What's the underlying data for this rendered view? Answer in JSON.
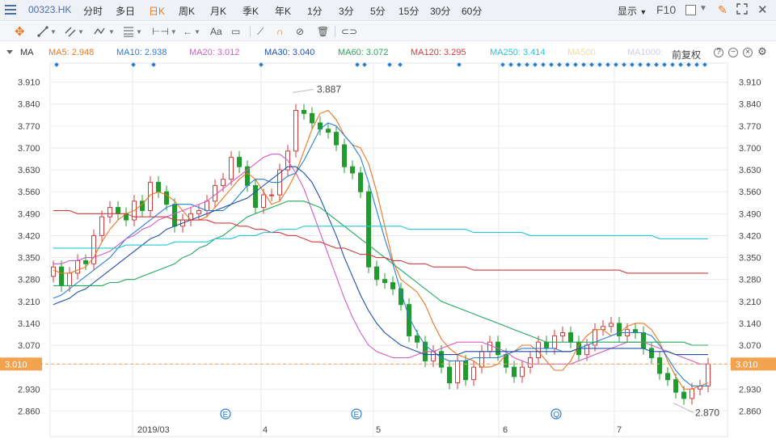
{
  "toolbar": {
    "stock_code": "00323.HK",
    "periods": [
      "分时",
      "多日",
      "日K",
      "周K",
      "月K",
      "季K",
      "年K",
      "1分",
      "3分",
      "5分",
      "15分",
      "30分",
      "60分"
    ],
    "active_period": "日K",
    "display_label": "显示",
    "f10_label": "F10"
  },
  "drawing_tools": {
    "text_tool_label": "Aa"
  },
  "ma": {
    "title": "MA",
    "items": [
      {
        "label": "MA5: 2.948",
        "color": "#e8771f"
      },
      {
        "label": "MA10: 2.938",
        "color": "#2a7fd4"
      },
      {
        "label": "MA20: 3.012",
        "color": "#d65ac5"
      },
      {
        "label": "MA30: 3.040",
        "color": "#1f4fa8"
      },
      {
        "label": "MA60: 3.072",
        "color": "#22a85a"
      },
      {
        "label": "MA120: 3.295",
        "color": "#d63a3a"
      },
      {
        "label": "MA250: 3.414",
        "color": "#24c6d8"
      },
      {
        "label": "MA500",
        "color": "#f0dc9a"
      },
      {
        "label": "MA1000:",
        "color": "#d7c9e8"
      }
    ],
    "adjust_label": "前复权"
  },
  "chart": {
    "y_ticks": [
      "3.910",
      "3.840",
      "3.770",
      "3.700",
      "3.630",
      "3.560",
      "3.490",
      "3.420",
      "3.350",
      "3.280",
      "3.210",
      "3.140",
      "3.070",
      "3.010",
      "2.930",
      "2.860"
    ],
    "current_price": "3.010",
    "high_label": "3.887",
    "low_label": "2.870",
    "x_labels": [
      "2019/03",
      "4",
      "5",
      "6",
      "7"
    ],
    "events": [
      "E",
      "E",
      "Q"
    ],
    "colors": {
      "up": "#d63a3a",
      "down": "#1f9c2c",
      "grid": "#e6ebf2",
      "current": "#f3a24d",
      "marker": "#2a7fd4"
    }
  },
  "chart_data": {
    "type": "candlestick",
    "ylim": [
      2.83,
      3.94
    ],
    "series": [
      {
        "name": "MA5",
        "values": [
          3.31,
          3.3,
          3.3,
          3.31,
          3.32,
          3.35,
          3.4,
          3.44,
          3.47,
          3.49,
          3.5,
          3.52,
          3.55,
          3.56,
          3.55,
          3.53,
          3.5,
          3.47,
          3.47,
          3.48,
          3.51,
          3.54,
          3.57,
          3.6,
          3.62,
          3.6,
          3.56,
          3.52,
          3.53,
          3.57,
          3.62,
          3.69,
          3.76,
          3.81,
          3.82,
          3.79,
          3.74,
          3.71,
          3.7,
          3.65,
          3.56,
          3.45,
          3.34,
          3.28,
          3.26,
          3.24,
          3.2,
          3.14,
          3.09,
          3.06,
          3.04,
          3.03,
          3.02,
          3.0,
          3.0,
          3.01,
          3.04,
          3.05,
          3.07,
          3.07,
          3.05,
          3.02,
          2.99,
          2.99,
          3.02,
          3.07,
          3.1,
          3.12,
          3.12,
          3.1,
          3.11,
          3.13,
          3.14,
          3.14,
          3.12,
          3.08,
          3.02,
          2.97,
          2.93,
          2.93,
          2.94,
          2.95
        ]
      },
      {
        "name": "MA10",
        "values": [
          3.22,
          3.23,
          3.25,
          3.27,
          3.29,
          3.31,
          3.33,
          3.35,
          3.38,
          3.41,
          3.43,
          3.45,
          3.47,
          3.49,
          3.51,
          3.52,
          3.52,
          3.52,
          3.51,
          3.5,
          3.5,
          3.5,
          3.52,
          3.55,
          3.58,
          3.6,
          3.6,
          3.59,
          3.59,
          3.61,
          3.62,
          3.66,
          3.71,
          3.76,
          3.78,
          3.77,
          3.74,
          3.71,
          3.67,
          3.59,
          3.5,
          3.41,
          3.33,
          3.24,
          3.16,
          3.11,
          3.07,
          3.05,
          3.03,
          3.02,
          3.02,
          3.02,
          3.03,
          3.03,
          3.03,
          3.03,
          3.04,
          3.05,
          3.06,
          3.06,
          3.06,
          3.06,
          3.06,
          3.05,
          3.05,
          3.06,
          3.07,
          3.08,
          3.09,
          3.1,
          3.11,
          3.11,
          3.11,
          3.11,
          3.1,
          3.07,
          3.03,
          2.99,
          2.96,
          2.94,
          2.94,
          2.94
        ]
      },
      {
        "name": "MA20",
        "values": [
          3.33,
          3.33,
          3.34,
          3.34,
          3.35,
          3.35,
          3.36,
          3.37,
          3.39,
          3.41,
          3.42,
          3.44,
          3.45,
          3.47,
          3.48,
          3.49,
          3.5,
          3.51,
          3.52,
          3.53,
          3.55,
          3.57,
          3.59,
          3.61,
          3.63,
          3.65,
          3.67,
          3.68,
          3.68,
          3.66,
          3.62,
          3.57,
          3.5,
          3.43,
          3.36,
          3.29,
          3.22,
          3.16,
          3.11,
          3.07,
          3.05,
          3.04,
          3.03,
          3.03,
          3.03,
          3.04,
          3.05,
          3.05,
          3.06,
          3.07,
          3.08,
          3.08,
          3.08,
          3.08,
          3.07,
          3.06,
          3.05,
          3.03,
          3.02,
          3.01,
          3.01,
          3.01,
          3.01,
          3.01,
          3.01,
          3.02,
          3.03,
          3.04,
          3.05,
          3.06,
          3.07,
          3.08,
          3.08,
          3.08,
          3.07,
          3.06,
          3.05,
          3.04,
          3.03,
          3.02,
          3.01,
          3.01
        ]
      },
      {
        "name": "MA30",
        "values": [
          3.2,
          3.21,
          3.22,
          3.24,
          3.25,
          3.27,
          3.29,
          3.31,
          3.33,
          3.35,
          3.37,
          3.39,
          3.41,
          3.42,
          3.44,
          3.45,
          3.46,
          3.47,
          3.48,
          3.49,
          3.5,
          3.51,
          3.52,
          3.53,
          3.54,
          3.56,
          3.58,
          3.6,
          3.62,
          3.64,
          3.64,
          3.62,
          3.59,
          3.54,
          3.48,
          3.42,
          3.35,
          3.29,
          3.23,
          3.18,
          3.14,
          3.11,
          3.09,
          3.07,
          3.06,
          3.05,
          3.04,
          3.04,
          3.04,
          3.04,
          3.04,
          3.05,
          3.05,
          3.05,
          3.05,
          3.05,
          3.05,
          3.05,
          3.05,
          3.05,
          3.05,
          3.05,
          3.05,
          3.05,
          3.05,
          3.06,
          3.06,
          3.06,
          3.06,
          3.06,
          3.06,
          3.06,
          3.06,
          3.06,
          3.05,
          3.05,
          3.05,
          3.04,
          3.04,
          3.04,
          3.04,
          3.04
        ]
      },
      {
        "name": "MA60",
        "values": [
          3.26,
          3.26,
          3.26,
          3.26,
          3.26,
          3.26,
          3.26,
          3.27,
          3.27,
          3.28,
          3.28,
          3.29,
          3.3,
          3.31,
          3.32,
          3.33,
          3.35,
          3.36,
          3.38,
          3.39,
          3.41,
          3.42,
          3.44,
          3.46,
          3.48,
          3.49,
          3.5,
          3.51,
          3.52,
          3.53,
          3.53,
          3.53,
          3.52,
          3.51,
          3.49,
          3.47,
          3.45,
          3.43,
          3.41,
          3.39,
          3.37,
          3.35,
          3.33,
          3.31,
          3.29,
          3.27,
          3.25,
          3.23,
          3.21,
          3.2,
          3.19,
          3.18,
          3.17,
          3.16,
          3.15,
          3.14,
          3.13,
          3.12,
          3.11,
          3.1,
          3.09,
          3.08,
          3.08,
          3.08,
          3.08,
          3.08,
          3.08,
          3.08,
          3.08,
          3.08,
          3.08,
          3.08,
          3.08,
          3.08,
          3.08,
          3.08,
          3.08,
          3.08,
          3.08,
          3.07,
          3.07,
          3.07
        ]
      },
      {
        "name": "MA120",
        "values": [
          3.5,
          3.5,
          3.5,
          3.49,
          3.49,
          3.49,
          3.49,
          3.49,
          3.49,
          3.49,
          3.48,
          3.48,
          3.48,
          3.48,
          3.48,
          3.47,
          3.47,
          3.47,
          3.47,
          3.47,
          3.46,
          3.46,
          3.46,
          3.45,
          3.45,
          3.44,
          3.44,
          3.43,
          3.43,
          3.42,
          3.42,
          3.41,
          3.4,
          3.4,
          3.39,
          3.38,
          3.38,
          3.37,
          3.36,
          3.36,
          3.35,
          3.35,
          3.34,
          3.34,
          3.33,
          3.33,
          3.33,
          3.32,
          3.32,
          3.32,
          3.32,
          3.32,
          3.31,
          3.31,
          3.31,
          3.31,
          3.31,
          3.31,
          3.31,
          3.31,
          3.31,
          3.31,
          3.31,
          3.31,
          3.31,
          3.31,
          3.31,
          3.31,
          3.31,
          3.31,
          3.31,
          3.3,
          3.3,
          3.3,
          3.3,
          3.3,
          3.3,
          3.3,
          3.3,
          3.3,
          3.3,
          3.3
        ]
      },
      {
        "name": "MA250",
        "values": [
          3.38,
          3.38,
          3.38,
          3.38,
          3.38,
          3.38,
          3.38,
          3.38,
          3.38,
          3.39,
          3.39,
          3.39,
          3.39,
          3.39,
          3.39,
          3.4,
          3.4,
          3.4,
          3.4,
          3.4,
          3.41,
          3.41,
          3.41,
          3.42,
          3.42,
          3.42,
          3.43,
          3.43,
          3.44,
          3.44,
          3.44,
          3.45,
          3.45,
          3.45,
          3.45,
          3.45,
          3.45,
          3.45,
          3.45,
          3.45,
          3.45,
          3.45,
          3.45,
          3.45,
          3.44,
          3.44,
          3.44,
          3.44,
          3.44,
          3.44,
          3.44,
          3.44,
          3.43,
          3.43,
          3.43,
          3.43,
          3.43,
          3.43,
          3.43,
          3.42,
          3.42,
          3.42,
          3.42,
          3.42,
          3.42,
          3.42,
          3.42,
          3.42,
          3.42,
          3.42,
          3.42,
          3.42,
          3.42,
          3.42,
          3.42,
          3.41,
          3.41,
          3.41,
          3.41,
          3.41,
          3.41,
          3.41
        ]
      },
      {
        "name": "close",
        "values": [
          3.32,
          3.26,
          3.3,
          3.34,
          3.33,
          3.42,
          3.48,
          3.51,
          3.49,
          3.47,
          3.53,
          3.5,
          3.59,
          3.56,
          3.52,
          3.45,
          3.47,
          3.49,
          3.5,
          3.53,
          3.58,
          3.6,
          3.67,
          3.64,
          3.58,
          3.51,
          3.55,
          3.55,
          3.63,
          3.69,
          3.82,
          3.81,
          3.78,
          3.76,
          3.75,
          3.71,
          3.64,
          3.62,
          3.56,
          3.32,
          3.28,
          3.27,
          3.25,
          3.2,
          3.1,
          3.08,
          3.02,
          3.05,
          3.0,
          2.95,
          3.02,
          2.96,
          3.0,
          3.05,
          3.08,
          3.04,
          3.0,
          2.97,
          3.0,
          3.03,
          3.08,
          3.06,
          3.1,
          3.11,
          3.08,
          3.04,
          3.07,
          3.12,
          3.13,
          3.14,
          3.1,
          3.12,
          3.11,
          3.06,
          3.03,
          2.98,
          2.96,
          2.92,
          2.9,
          2.93,
          2.94,
          3.01
        ]
      }
    ]
  }
}
